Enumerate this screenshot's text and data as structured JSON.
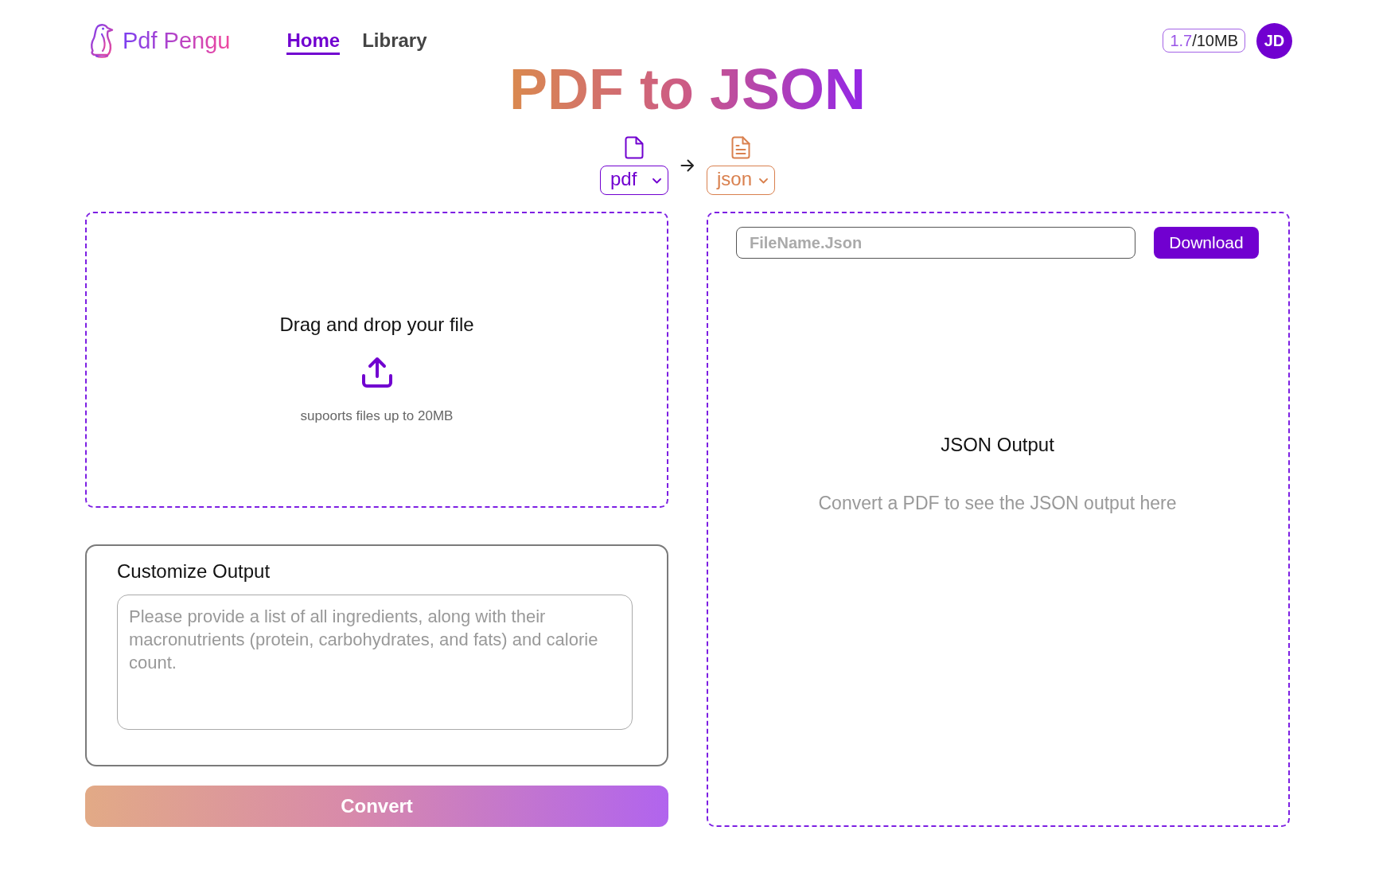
{
  "header": {
    "logo": {
      "text": "Pdf Pengu"
    },
    "nav": [
      {
        "label": "Home",
        "selected": true
      },
      {
        "label": "Library",
        "selected": false
      }
    ],
    "usage": {
      "used": "1.7",
      "limit": "/10MB"
    },
    "avatar": {
      "initials": "JD"
    }
  },
  "title": "PDF to JSON",
  "formats": [
    {
      "kind": "source",
      "value": "pdf",
      "color": "#7100d0"
    },
    {
      "kind": "target",
      "value": "json",
      "color": "#d9804e"
    }
  ],
  "upload": {
    "title": "Drag and drop your file",
    "note": "supoorts files up to 20MB"
  },
  "customize": {
    "title": "Customize Output",
    "placeholder": "Please provide a list of all ingredients, along with their macronutrients (protein, carbohydrates, and fats) and calorie count."
  },
  "convert_button": "Convert",
  "output": {
    "filename": {
      "placeholder": "FileName.Json"
    },
    "download_button": "Download",
    "title": "JSON Output",
    "empty_message": "Convert a PDF to see the JSON output here"
  }
}
